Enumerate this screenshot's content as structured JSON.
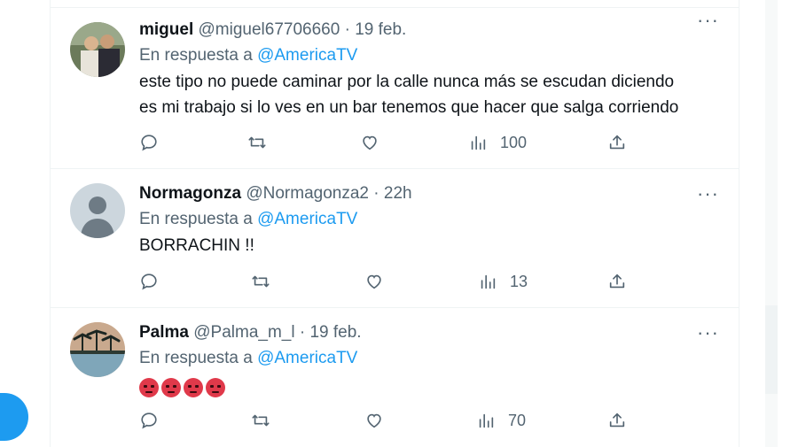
{
  "tweets": [
    {
      "name": "miguel",
      "handle": "@miguel67706660",
      "time": "19 feb.",
      "reply_prefix": "En respuesta a ",
      "reply_to": "@AmericaTV",
      "text_lines": [
        "este tipo no puede caminar por la calle nunca más se escudan diciendo",
        "es mi trabajo si lo ves en un bar tenemos que hacer que salga corriendo"
      ],
      "views": "100",
      "avatar_icon": "user-photo-avatar"
    },
    {
      "name": "Normagonza",
      "handle": "@Normagonza2",
      "time": "22h",
      "reply_prefix": "En respuesta a ",
      "reply_to": "@AmericaTV",
      "text_lines": [
        "BORRACHIN !!"
      ],
      "views": "13",
      "avatar_icon": "default-avatar-icon"
    },
    {
      "name": "Palma",
      "handle": "@Palma_m_l",
      "time": "19 feb.",
      "reply_prefix": "En respuesta a ",
      "reply_to": "@AmericaTV",
      "emojis": [
        "angry-face",
        "angry-face",
        "angry-face",
        "angry-face"
      ],
      "views": "70",
      "avatar_icon": "palm-beach-avatar"
    }
  ],
  "ui": {
    "dot_separator": "·",
    "more_label": "···",
    "accent_color": "#1d9bf0",
    "secondary_text_color": "#536471"
  }
}
